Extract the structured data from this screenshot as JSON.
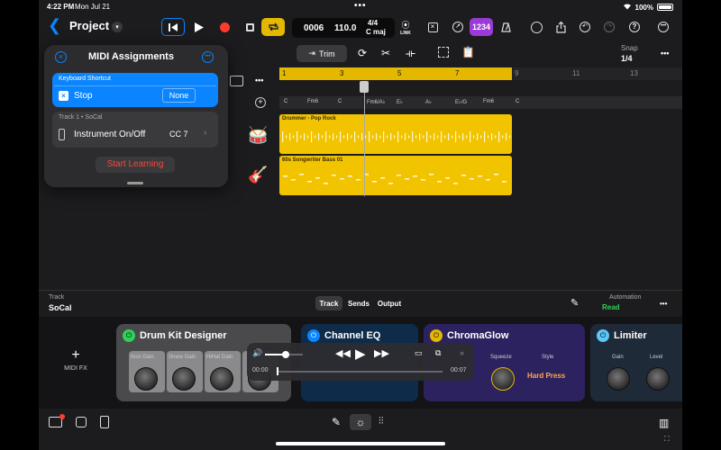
{
  "status": {
    "time": "4:22 PM",
    "date": "Mon Jul 21",
    "battery": "100%"
  },
  "toolbar": {
    "back_icon": "chevron-left-icon",
    "project_title": "Project",
    "position": "0006",
    "tempo": "110.0",
    "time_signature": "4/4",
    "key": "C maj",
    "link_label": "LINK",
    "count_in": "1234"
  },
  "edit_bar": {
    "trim_label": "Trim",
    "snap_label": "Snap",
    "snap_value": "1/4"
  },
  "ruler": {
    "bars": [
      "1",
      "3",
      "5",
      "7",
      "9",
      "11",
      "13"
    ]
  },
  "chords": [
    "C",
    "Fm6",
    "C",
    "Fm6/A♭",
    "E♭",
    "A♭",
    "E♭/G",
    "Fm6",
    "C"
  ],
  "regions": [
    {
      "name": "Drummer - Pop Rock"
    },
    {
      "name": "60s Songwriter Bass 01"
    }
  ],
  "midi_panel": {
    "title": "MIDI Assignments",
    "shortcut_header": "Keyboard Shortcut",
    "shortcut_command": "Stop",
    "shortcut_value": "None",
    "assignment_header": "Track 1 • SoCal",
    "assignment_label": "Instrument On/Off",
    "assignment_value": "CC 7",
    "learn_button": "Start Learning"
  },
  "track_bar": {
    "track_label": "Track",
    "track_name": "SoCal",
    "tabs": [
      "Track",
      "Sends",
      "Output"
    ],
    "automation_label": "Automation",
    "automation_value": "Read"
  },
  "plugins": {
    "midi_fx_label": "MIDI FX",
    "drum_kit": {
      "title": "Drum Kit Designer",
      "knobs": [
        "Kick Gain",
        "Snare Gain",
        "HiHat Gain"
      ]
    },
    "channel_eq": {
      "title": "Channel EQ"
    },
    "chromaglow": {
      "title": "ChromaGlow",
      "knob": "Squeeze",
      "style_label": "Style",
      "style_value": "Hard Press"
    },
    "limiter": {
      "title": "Limiter",
      "knobs": [
        "Gain",
        "Level"
      ]
    }
  },
  "player": {
    "elapsed": "00:00",
    "total": "00:07",
    "progress": 0.0,
    "volume": 0.55
  },
  "colors": {
    "accent": "#0a84ff",
    "region": "#f2c400",
    "ruler": "#e5b800",
    "record": "#ff3b30",
    "learn": "#ff453a",
    "count_in": "#9b3ad6",
    "automation": "#30d158"
  }
}
